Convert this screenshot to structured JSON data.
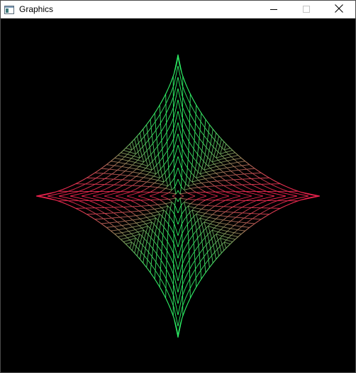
{
  "window": {
    "title": "Graphics"
  },
  "icons": {
    "app": "app-window-icon",
    "minimize": "minimize-icon",
    "maximize": "maximize-icon",
    "close": "close-icon"
  },
  "colors": {
    "background": "#000000",
    "tip_color": "#2ef066",
    "side_color": "#f0234f"
  },
  "graphic": {
    "shape": "astroid line mesh",
    "grid_lines_per_direction": 25
  }
}
